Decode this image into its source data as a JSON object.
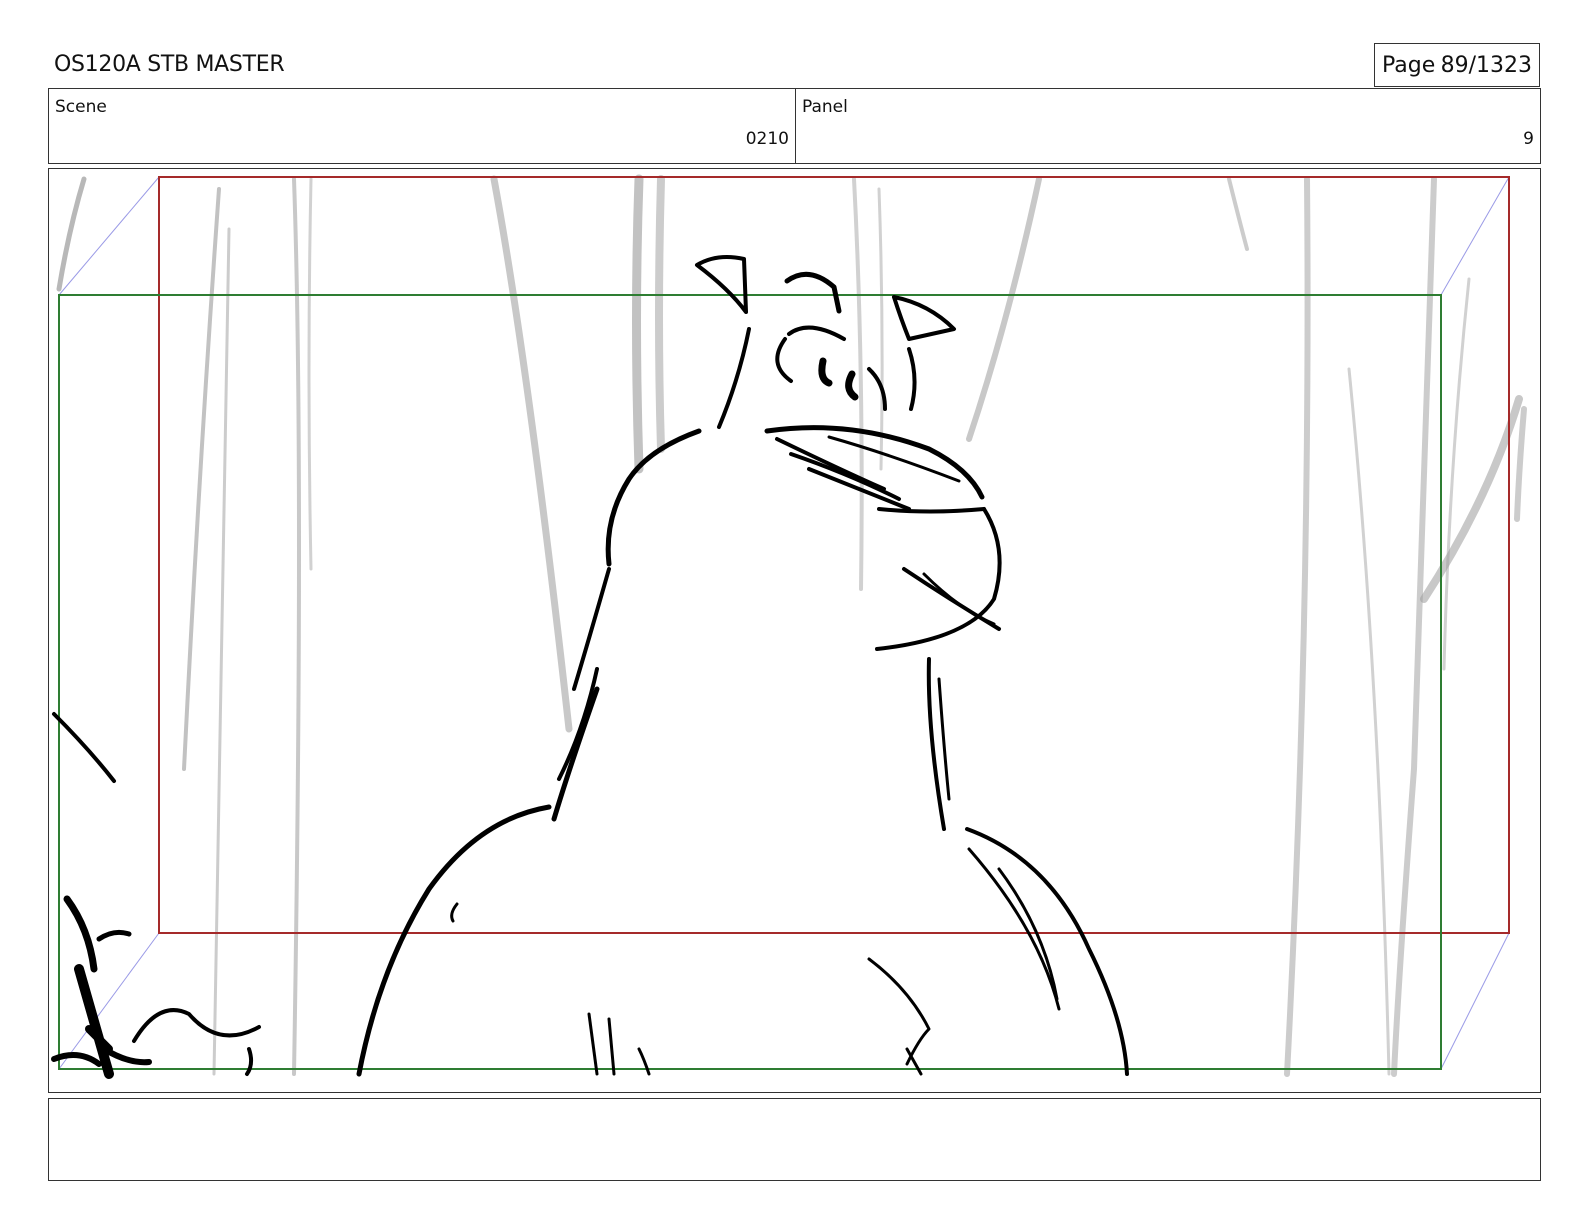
{
  "header": {
    "title": "OS120A STB MASTER",
    "page_label": "Page",
    "page_value": "89/1323"
  },
  "info": {
    "scene_label": "Scene",
    "scene_value": "0210",
    "panel_label": "Panel",
    "panel_value": "9"
  },
  "notes": {
    "text": ""
  },
  "colors": {
    "outer_frame": "#a52a2a",
    "inner_frame": "#2e7d32",
    "perspective_lines": "#9a9ae6",
    "ink": "#000000",
    "background_trees": "#9a9a9a"
  }
}
